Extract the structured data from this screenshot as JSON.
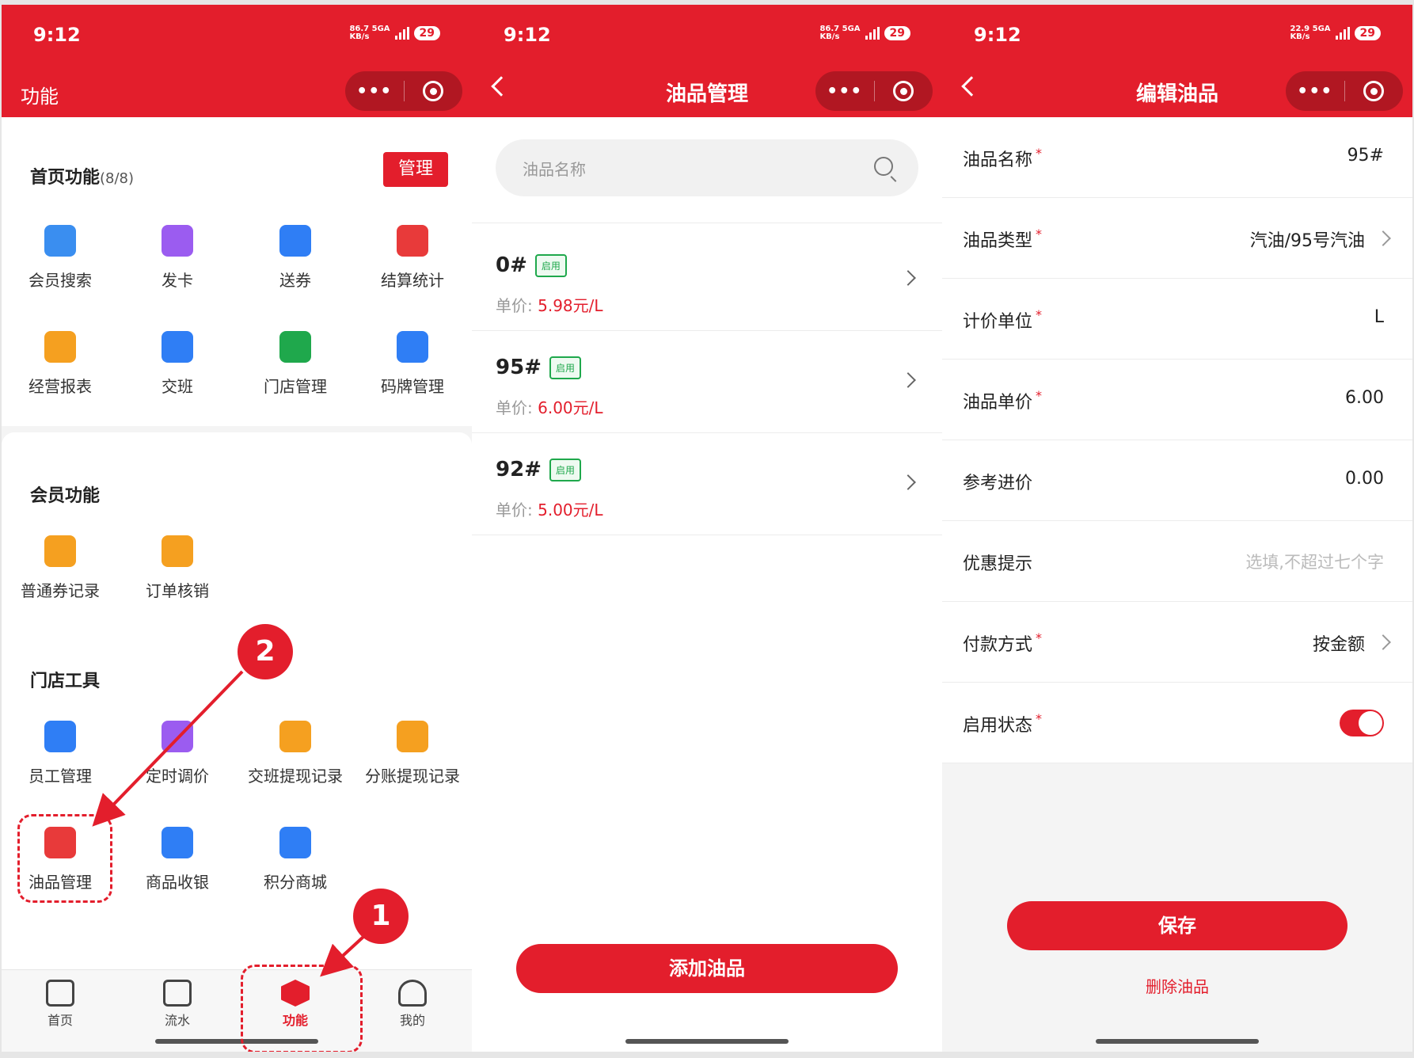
{
  "status": {
    "time": "9:12",
    "battery": "29",
    "net_speed_1": "86.7",
    "net_speed_3": "22.9",
    "net_unit": "KB/s",
    "net_type": "5GA"
  },
  "panel1": {
    "nav_title": "功能",
    "home_section": {
      "title": "首页功能",
      "count": "(8/8)",
      "manage_label": "管理",
      "items": [
        {
          "label": "会员搜索",
          "icon": "member-search-icon",
          "color": "#3a8ef0"
        },
        {
          "label": "发卡",
          "icon": "vip-card-icon",
          "color": "#9b5cf0"
        },
        {
          "label": "送券",
          "icon": "send-coupon-icon",
          "color": "#2f7ef5"
        },
        {
          "label": "结算统计",
          "icon": "settlement-icon",
          "color": "#e83a3a"
        },
        {
          "label": "经营报表",
          "icon": "report-icon",
          "color": "#f5a020"
        },
        {
          "label": "交班",
          "icon": "shift-icon",
          "color": "#2f7ef5"
        },
        {
          "label": "门店管理",
          "icon": "store-icon",
          "color": "#1fa84c"
        },
        {
          "label": "码牌管理",
          "icon": "qr-plate-icon",
          "color": "#2f7ef5"
        }
      ]
    },
    "member_section": {
      "title": "会员功能",
      "items": [
        {
          "label": "普通券记录",
          "icon": "coupon-record-icon",
          "color": "#f5a020"
        },
        {
          "label": "订单核销",
          "icon": "order-verify-icon",
          "color": "#f5a020"
        }
      ]
    },
    "tools_section": {
      "title": "门店工具",
      "items": [
        {
          "label": "员工管理",
          "icon": "staff-icon",
          "color": "#2f7ef5"
        },
        {
          "label": "定时调价",
          "icon": "timer-price-icon",
          "color": "#9b5cf0"
        },
        {
          "label": "交班提现记录",
          "icon": "shift-withdraw-icon",
          "color": "#f5a020"
        },
        {
          "label": "分账提现记录",
          "icon": "split-withdraw-icon",
          "color": "#f5a020"
        },
        {
          "label": "油品管理",
          "icon": "fuel-icon",
          "color": "#e83a3a"
        },
        {
          "label": "商品收银",
          "icon": "shop-bag-icon",
          "color": "#2f7ef5"
        },
        {
          "label": "积分商城",
          "icon": "points-db-icon",
          "color": "#2f7ef5"
        }
      ]
    },
    "tabs": [
      {
        "label": "首页",
        "icon": "home-icon"
      },
      {
        "label": "流水",
        "icon": "ledger-icon"
      },
      {
        "label": "功能",
        "icon": "function-icon"
      },
      {
        "label": "我的",
        "icon": "profile-icon"
      }
    ],
    "callouts": [
      "1",
      "2"
    ]
  },
  "panel2": {
    "nav_title": "油品管理",
    "search_placeholder": "油品名称",
    "price_prefix": "单价: ",
    "oils": [
      {
        "name": "0#",
        "tag": "启用",
        "price": "5.98元/L"
      },
      {
        "name": "95#",
        "tag": "启用",
        "price": "6.00元/L"
      },
      {
        "name": "92#",
        "tag": "启用",
        "price": "5.00元/L"
      }
    ],
    "add_button": "添加油品"
  },
  "panel3": {
    "nav_title": "编辑油品",
    "required_mark": "*",
    "fields": [
      {
        "label": "油品名称",
        "value": "95#"
      },
      {
        "label": "油品类型",
        "value": "汽油/95号汽油"
      },
      {
        "label": "计价单位",
        "value": "L"
      },
      {
        "label": "油品单价",
        "value": "6.00"
      },
      {
        "label": "参考进价",
        "value": "0.00"
      },
      {
        "label": "优惠提示",
        "placeholder": "选填,不超过七个字"
      },
      {
        "label": "付款方式",
        "value": "按金额"
      },
      {
        "label": "启用状态"
      }
    ],
    "enabled": true,
    "save_button": "保存",
    "delete_link": "删除油品"
  },
  "colors": {
    "brand_red": "#e31e2c",
    "tag_green": "#1fa84c"
  }
}
